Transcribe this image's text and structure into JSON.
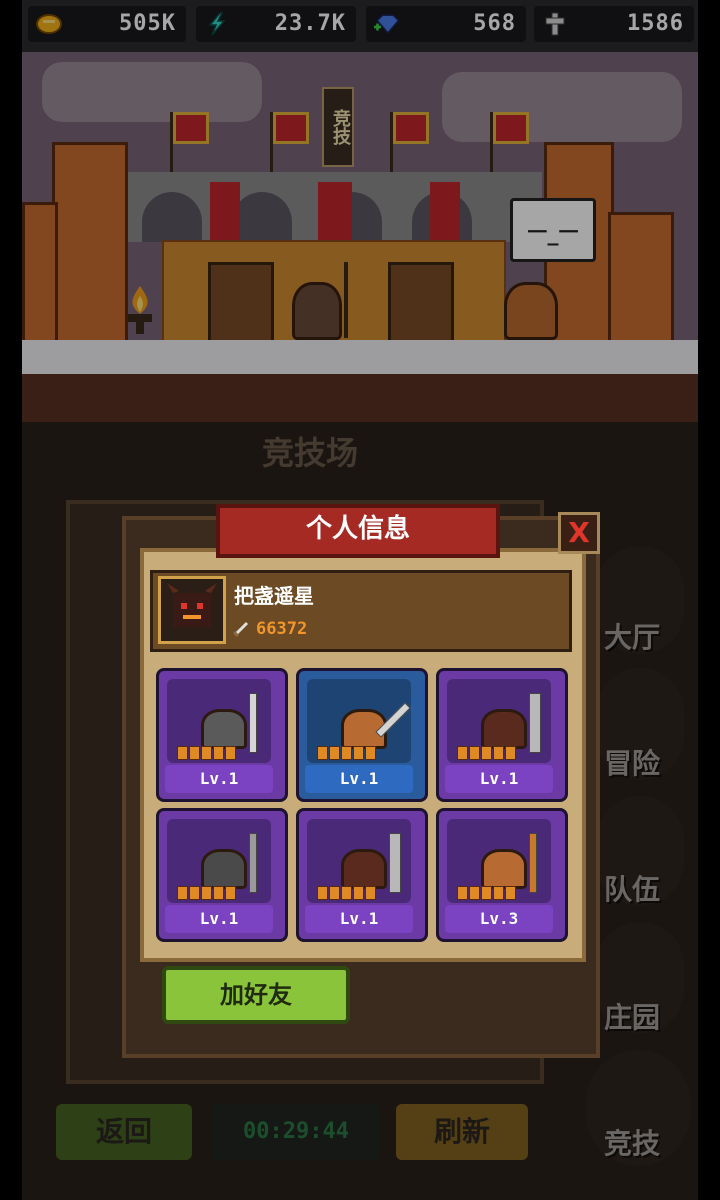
{
  "resources": [
    {
      "icon": "gold-icon",
      "value": "505K",
      "color": "#f5b31b"
    },
    {
      "icon": "energy-icon",
      "value": "23.7K",
      "color": "#2ed8c8"
    },
    {
      "icon": "gem-icon",
      "value": "568",
      "color": "#4a7bea"
    },
    {
      "icon": "cross-icon",
      "value": "1586",
      "color": "#d8d8d8"
    }
  ],
  "scene": {
    "sign_text": "竞技",
    "speech_face": "ㅡ_ㅡ"
  },
  "arena_title": "竞技场",
  "side_nav": [
    {
      "label": "大厅"
    },
    {
      "label": "冒险"
    },
    {
      "label": "队伍"
    },
    {
      "label": "庄园"
    },
    {
      "label": "竞技"
    }
  ],
  "bottom": {
    "back": "返回",
    "timer": "00:29:44",
    "refresh": "刷新"
  },
  "modal": {
    "title": "个人信息",
    "close": "X",
    "player_name": "把盏遥星",
    "power": "66372",
    "add_friend": "加好友",
    "heroes": [
      {
        "level": "Lv.1",
        "stars": 5,
        "rarity": "purple"
      },
      {
        "level": "Lv.1",
        "stars": 5,
        "rarity": "blue"
      },
      {
        "level": "Lv.1",
        "stars": 5,
        "rarity": "purple"
      },
      {
        "level": "Lv.1",
        "stars": 5,
        "rarity": "purple"
      },
      {
        "level": "Lv.1",
        "stars": 5,
        "rarity": "purple"
      },
      {
        "level": "Lv.3",
        "stars": 5,
        "rarity": "purple"
      }
    ]
  }
}
